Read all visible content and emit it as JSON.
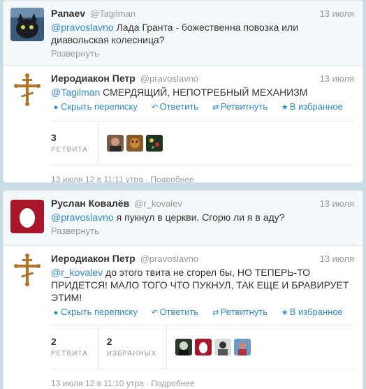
{
  "thread1": {
    "parent": {
      "fullname": "Panaev",
      "username": "@Tagilman",
      "time": "13 июля",
      "mention": "@pravoslavno",
      "text": " Лада Гранта - божественна повозка или диавольская колесница?",
      "expand": "Развернуть"
    },
    "reply": {
      "fullname": "Иеродиакон Петр",
      "username": "@pravoslavno",
      "time": "13 июля",
      "mention": "@Tagilman",
      "text": " СМЕРДЯЩИЙ, НЕПОТРЕБНЫЙ МЕХАНИЗМ",
      "actions": {
        "hide": "Скрыть переписку",
        "reply": "Ответить",
        "retweet": "Ретвитнуть",
        "favorite": "В избранное"
      },
      "stats": [
        {
          "num": "3",
          "label": "РЕТВИТА"
        }
      ],
      "meta": "13 июля 12 в 11:11 утра · Подробнее"
    }
  },
  "thread2": {
    "parent": {
      "fullname": "Руслан Ковалёв",
      "username": "@r_kovalev",
      "time": "13 июля",
      "mention": "@pravoslavno",
      "text": " я пукнул в церкви. Сгорю ли я в аду?",
      "expand": "Развернуть"
    },
    "reply": {
      "fullname": "Иеродиакон Петр",
      "username": "@pravoslavno",
      "time": "13 июля",
      "mention": "@r_kovalev",
      "text": " до этого твита не сгорел бы, НО ТЕПЕРЬ-ТО ПРИДЕТСЯ! МАЛО ТОГО ЧТО ПУКНУЛ, ТАК ЕЩЕ И БРАВИРУЕТ ЭТИМ!",
      "actions": {
        "hide": "Скрыть переписку",
        "reply": "Ответить",
        "retweet": "Ретвитнуть",
        "favorite": "В избранное"
      },
      "stats": [
        {
          "num": "2",
          "label": "РЕТВИТА"
        },
        {
          "num": "2",
          "label": "ИЗБРАННЫХ"
        }
      ],
      "meta": "13 июля 12 в 11:10 утра · Подробнее"
    }
  },
  "icons": {
    "hide": "comment-icon",
    "reply": "reply-icon",
    "retweet": "retweet-icon",
    "favorite": "star-icon"
  },
  "colors": {
    "link": "#2f89c9",
    "background": "#c9dbe3"
  }
}
